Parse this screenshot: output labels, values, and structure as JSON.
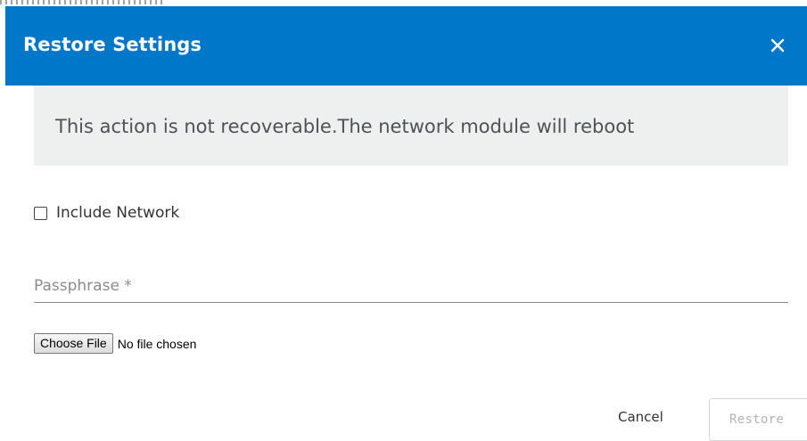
{
  "dialog": {
    "title": "Restore Settings",
    "header_color": "#0077c8",
    "close_icon": "close-icon"
  },
  "warning": {
    "message": "This action is not recoverable.The network module will reboot"
  },
  "include_network": {
    "label": "Include Network",
    "checked": false
  },
  "passphrase": {
    "placeholder": "Passphrase *",
    "value": ""
  },
  "file_picker": {
    "button_label": "Choose File",
    "status": "No file chosen"
  },
  "actions": {
    "cancel_label": "Cancel",
    "restore_label": "Restore",
    "restore_disabled": true
  }
}
